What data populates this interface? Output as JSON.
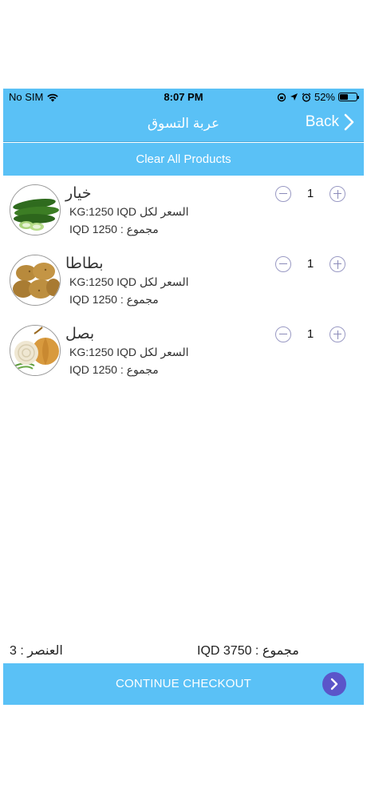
{
  "status_bar": {
    "carrier": "No SIM",
    "time": "8:07 PM",
    "battery": "52%",
    "battery_level": 0.52,
    "icons": [
      "wifi-icon",
      "rotation-lock-icon",
      "location-icon",
      "alarm-icon",
      "battery-icon"
    ]
  },
  "nav": {
    "title": "عربة التسوق",
    "back_label": "Back"
  },
  "clear_label": "Clear All Products",
  "items": [
    {
      "name": "خيار",
      "unit_price": "KG:1250 IQD السعر لكل",
      "total": "IQD 1250 : مجموع",
      "quantity": "1",
      "image": "cucumber-image"
    },
    {
      "name": "بطاطا",
      "unit_price": "KG:1250 IQD السعر لكل",
      "total": "IQD 1250 : مجموع",
      "quantity": "1",
      "image": "potato-image"
    },
    {
      "name": "بصل",
      "unit_price": "KG:1250 IQD السعر لكل",
      "total": "IQD 1250 : مجموع",
      "quantity": "1",
      "image": "onion-image"
    }
  ],
  "summary": {
    "item_count": "العنصر : 3",
    "grand_total": "IQD 3750 : مجموع"
  },
  "checkout_label": "CONTINUE CHECKOUT",
  "colors": {
    "accent": "#5ac1f6",
    "checkout_arrow": "#5b55c9",
    "stepper": "#8a8ab8"
  }
}
